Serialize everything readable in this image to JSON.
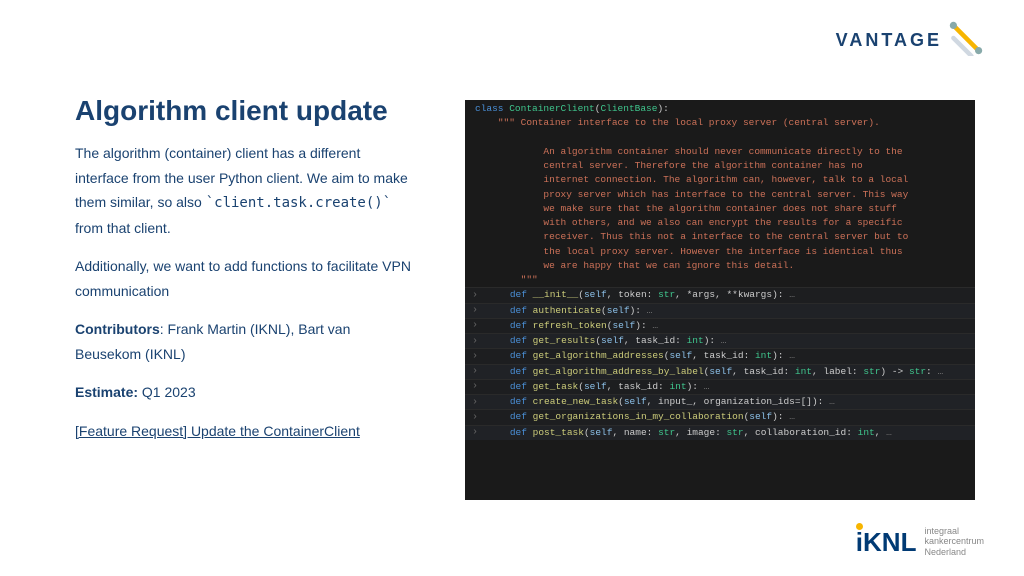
{
  "brand": {
    "name": "VANTAGE"
  },
  "heading": "Algorithm client update",
  "para1_a": "The algorithm (container) client has a different interface from the user Python client. We aim to make them similar, so also ",
  "para1_code": "`client.task.create()`",
  "para1_b": " from that client.",
  "para2": "Additionally, we want to add functions to facilitate VPN communication",
  "contrib_label": "Contributors",
  "contrib_text": ": Frank Martin (IKNL), Bart van Beusekom (IKNL)",
  "estimate_label": "Estimate:",
  "estimate_text": " Q1 2023",
  "link_text": "[Feature Request] Update the ContainerClient",
  "code": {
    "class_kw": "class",
    "class_name": "ContainerClient",
    "base": "ClientBase",
    "doc": "\"\"\" Container interface to the local proxy server (central server).\n\n        An algorithm container should never communicate directly to the\n        central server. Therefore the algorithm container has no\n        internet connection. The algorithm can, however, talk to a local\n        proxy server which has interface to the central server. This way\n        we make sure that the algorithm container does not share stuff\n        with others, and we also can encrypt the results for a specific\n        receiver. Thus this not a interface to the central server but to\n        the local proxy server. However the interface is identical thus\n        we are happy that we can ignore this detail.\n    \"\"\"",
    "methods": [
      {
        "sig": "def __init__(self, token: str, *args, **kwargs):"
      },
      {
        "sig": "def authenticate(self):"
      },
      {
        "sig": "def refresh_token(self):"
      },
      {
        "sig": "def get_results(self, task_id: int):"
      },
      {
        "sig": "def get_algorithm_addresses(self, task_id: int):"
      },
      {
        "sig": "def get_algorithm_address_by_label(self, task_id: int, label: str) -> str:"
      },
      {
        "sig": "def get_task(self, task_id: int):"
      },
      {
        "sig": "def create_new_task(self, input_, organization_ids=[]):"
      },
      {
        "sig": "def get_organizations_in_my_collaboration(self):"
      },
      {
        "sig": "def post_task(self, name: str, image: str, collaboration_id: int,"
      }
    ]
  },
  "footer": {
    "mark": "iKNL",
    "line1": "integraal",
    "line2": "kankercentrum",
    "line3": "Nederland"
  }
}
